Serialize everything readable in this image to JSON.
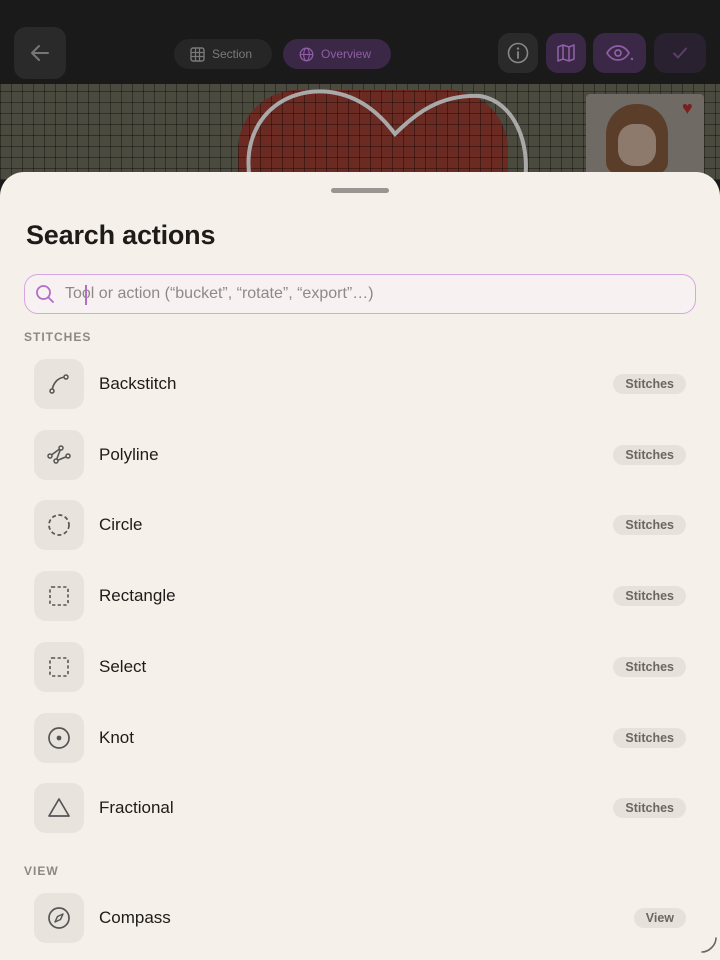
{
  "app": {
    "tabs": [
      {
        "label": "Section"
      },
      {
        "label": "Overview"
      }
    ]
  },
  "sheet": {
    "title": "Search actions",
    "search": {
      "value": "",
      "placeholder": "Tool or action (“bucket”, “rotate”, “export”…)"
    },
    "sections": [
      {
        "header": "STITCHES",
        "items": [
          {
            "label": "Backstitch",
            "badge": "Stitches",
            "icon": "backstitch-curve-icon"
          },
          {
            "label": "Polyline",
            "badge": "Stitches",
            "icon": "polyline-icon"
          },
          {
            "label": "Circle",
            "badge": "Stitches",
            "icon": "dashed-circle-icon"
          },
          {
            "label": "Rectangle",
            "badge": "Stitches",
            "icon": "dashed-square-icon"
          },
          {
            "label": "Select",
            "badge": "Stitches",
            "icon": "dashed-square-icon"
          },
          {
            "label": "Knot",
            "badge": "Stitches",
            "icon": "knot-circle-icon"
          },
          {
            "label": "Fractional",
            "badge": "Stitches",
            "icon": "triangle-icon"
          }
        ]
      },
      {
        "header": "VIEW",
        "items": [
          {
            "label": "Compass",
            "badge": "View",
            "icon": "compass-icon"
          }
        ]
      }
    ]
  },
  "colors": {
    "accent": "#b06ec8",
    "sheet_bg": "#f6f0ea",
    "search_border": "#d6a6e2",
    "badge_bg": "#e7e1dc"
  }
}
